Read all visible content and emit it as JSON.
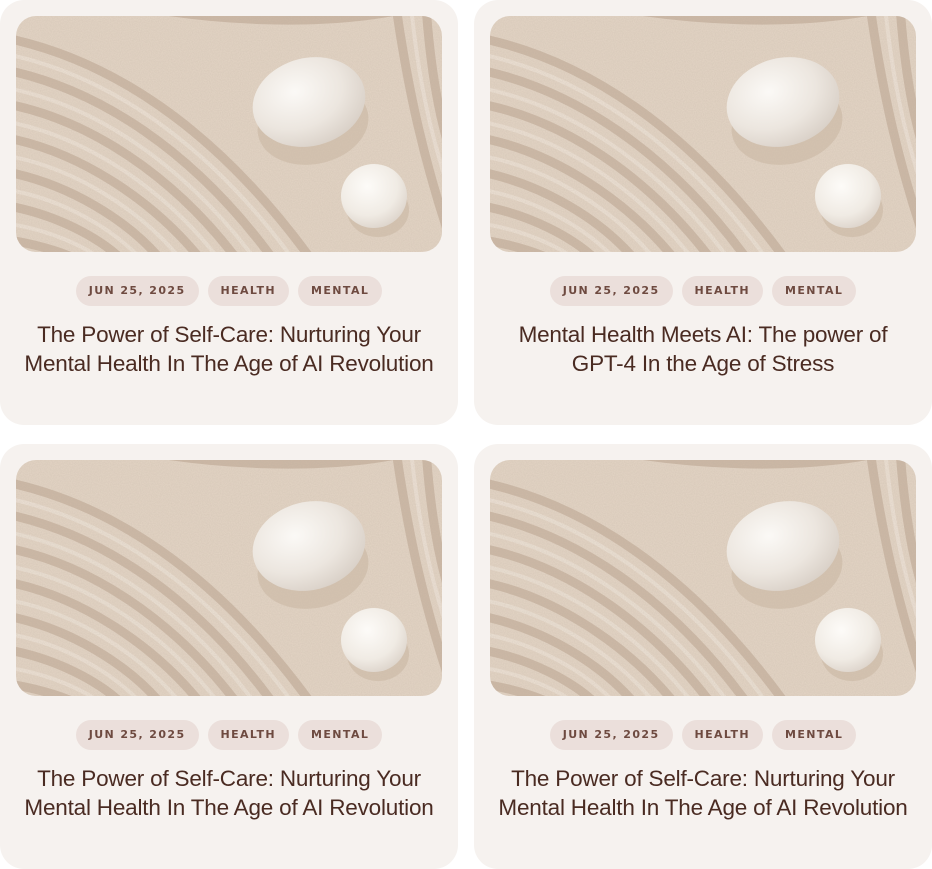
{
  "posts": [
    {
      "image_alt": "zen sand garden with stones",
      "tags": [
        "JUN 25, 2025",
        "HEALTH",
        "MENTAL"
      ],
      "title": "The Power of Self-Care: Nurturing Your Mental Health In The Age of AI Revolution"
    },
    {
      "image_alt": "zen sand garden with stones",
      "tags": [
        "JUN 25, 2025",
        "HEALTH",
        "MENTAL"
      ],
      "title": "Mental Health Meets AI: The power of GPT-4 In the Age of Stress"
    },
    {
      "image_alt": "zen sand garden with stones",
      "tags": [
        "JUN 25, 2025",
        "HEALTH",
        "MENTAL"
      ],
      "title": "The Power of Self-Care: Nurturing Your Mental Health In The Age of AI Revolution"
    },
    {
      "image_alt": "zen sand garden with stones",
      "tags": [
        "JUN 25, 2025",
        "HEALTH",
        "MENTAL"
      ],
      "title": "The Power of Self-Care: Nurturing Your Mental Health In The Age of AI Revolution"
    }
  ],
  "colors": {
    "card_bg": "#f6f2ef",
    "tag_bg": "#ebdfdb",
    "tag_text": "#6e4a40",
    "title_text": "#4a2b22",
    "sand": "#e3d4c4"
  }
}
